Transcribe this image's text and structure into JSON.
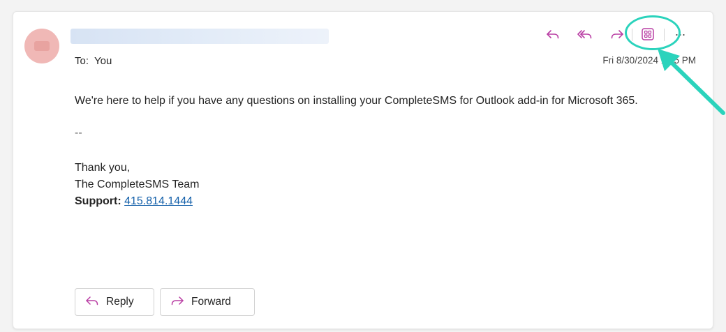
{
  "header": {
    "to_label": "To:",
    "to_value": "You",
    "date": "Fri 8/30/2024 1:05 PM"
  },
  "toolbar": {
    "icons": [
      "reply-icon",
      "reply-all-icon",
      "forward-icon",
      "apps-icon",
      "more-icon"
    ],
    "more_label": "···"
  },
  "message": {
    "line1": "We're here to help if you have any questions on installing your CompleteSMS for Outlook add-in for Microsoft 365.",
    "separator": "--",
    "closing": "Thank you,",
    "team": "The CompleteSMS Team",
    "support_label": "Support:",
    "support_phone": "415.814.1444"
  },
  "actions": {
    "reply_label": "Reply",
    "forward_label": "Forward"
  },
  "colors": {
    "accent": "#b93ea4",
    "highlight": "#2bd3bc",
    "link": "#1460aa"
  }
}
